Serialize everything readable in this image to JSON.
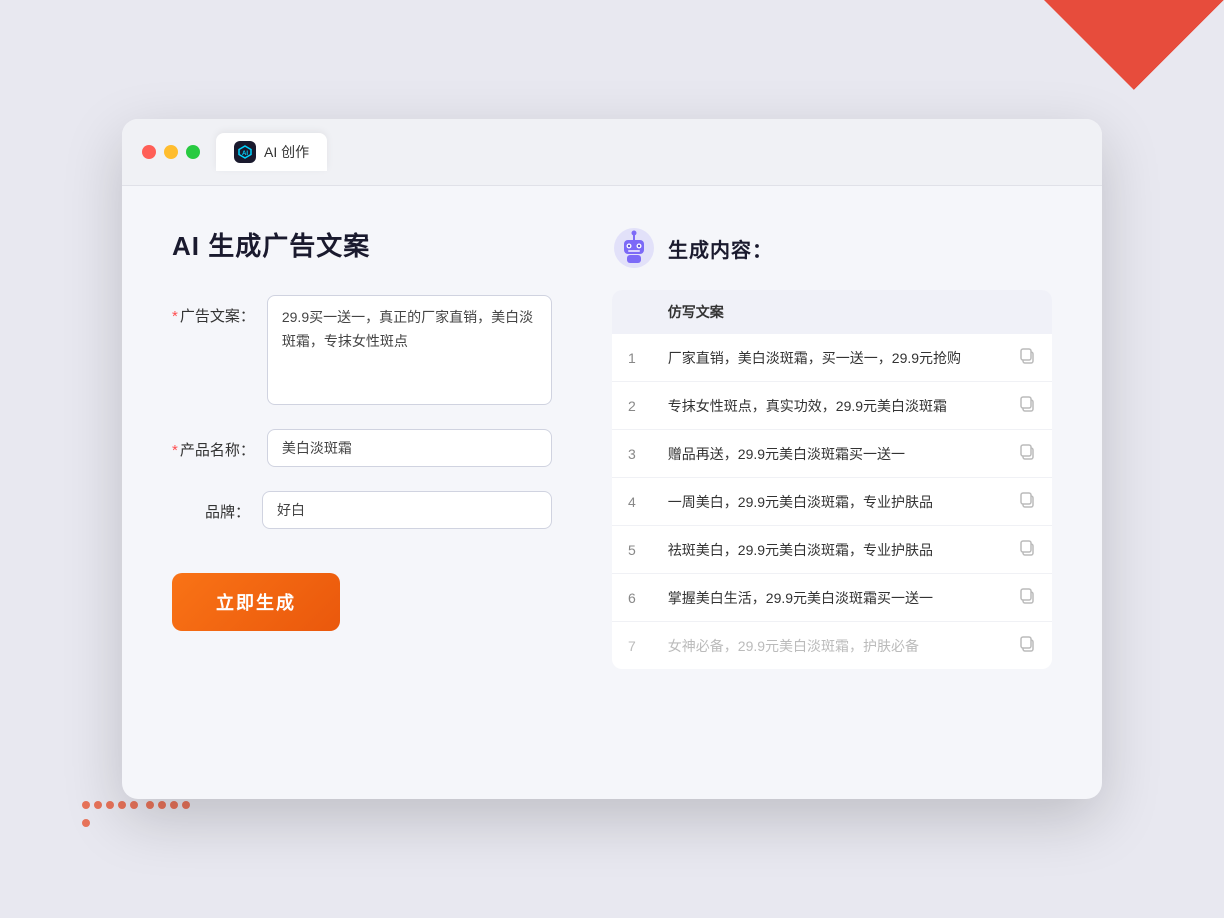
{
  "window": {
    "tab_label": "AI 创作",
    "ai_icon_text": "AI"
  },
  "left_panel": {
    "title": "AI 生成广告文案",
    "form": {
      "ad_copy_label": "广告文案：",
      "ad_copy_required": "*",
      "ad_copy_value": "29.9买一送一，真正的厂家直销，美白淡斑霜，专抹女性斑点",
      "product_name_label": "产品名称：",
      "product_name_required": "*",
      "product_name_value": "美白淡斑霜",
      "brand_label": "品牌：",
      "brand_value": "好白",
      "generate_btn": "立即生成"
    }
  },
  "right_panel": {
    "title": "生成内容：",
    "table_header": "仿写文案",
    "results": [
      {
        "id": 1,
        "text": "厂家直销，美白淡斑霜，买一送一，29.9元抢购",
        "faded": false
      },
      {
        "id": 2,
        "text": "专抹女性斑点，真实功效，29.9元美白淡斑霜",
        "faded": false
      },
      {
        "id": 3,
        "text": "赠品再送，29.9元美白淡斑霜买一送一",
        "faded": false
      },
      {
        "id": 4,
        "text": "一周美白，29.9元美白淡斑霜，专业护肤品",
        "faded": false
      },
      {
        "id": 5,
        "text": "祛斑美白，29.9元美白淡斑霜，专业护肤品",
        "faded": false
      },
      {
        "id": 6,
        "text": "掌握美白生活，29.9元美白淡斑霜买一送一",
        "faded": false
      },
      {
        "id": 7,
        "text": "女神必备，29.9元美白淡斑霜，护肤必备",
        "faded": true
      }
    ]
  }
}
